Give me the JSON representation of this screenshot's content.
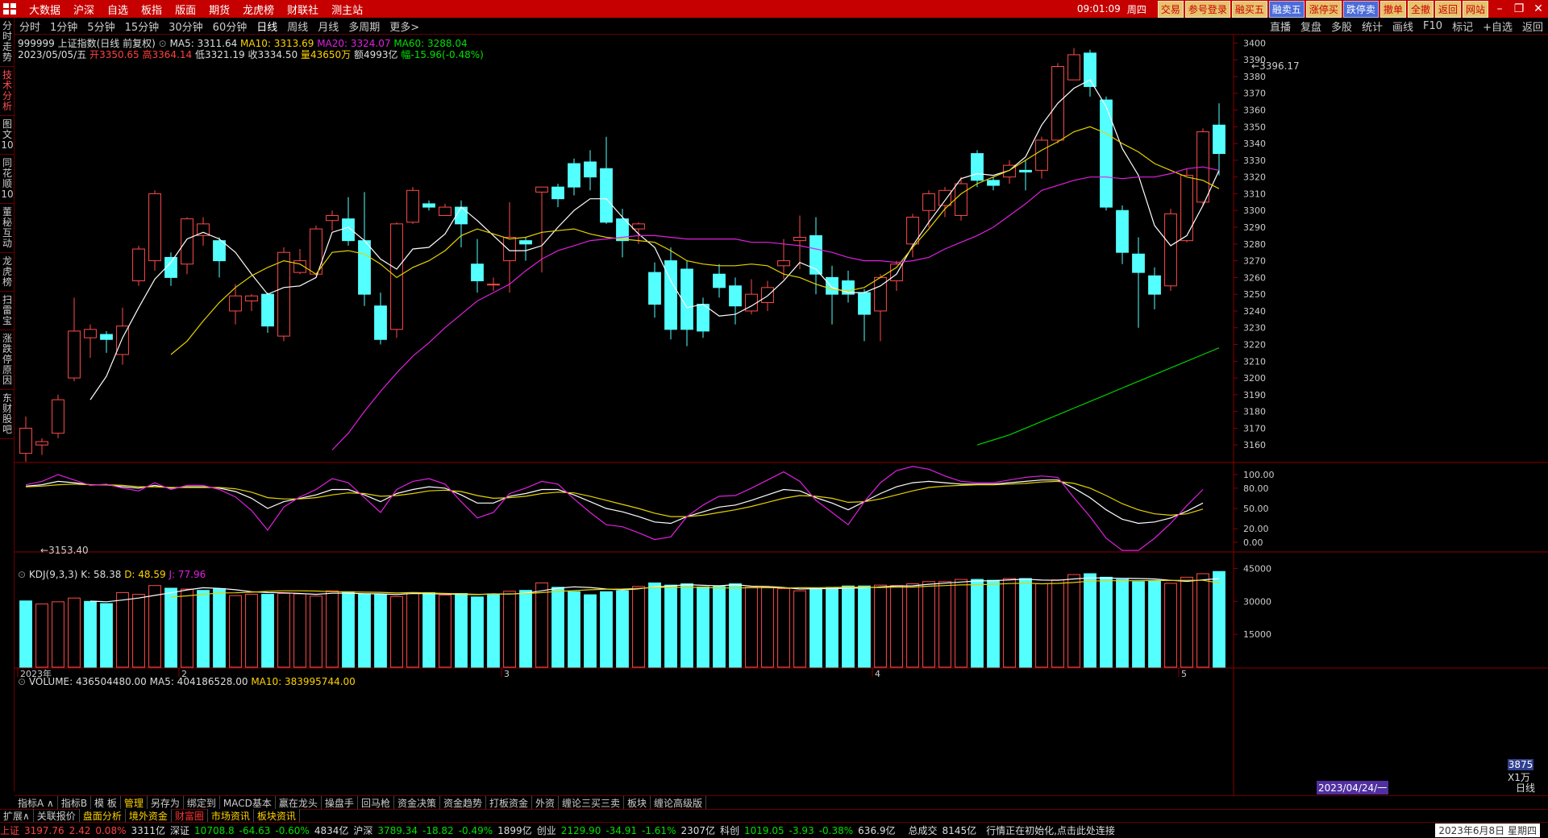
{
  "menu": {
    "items": [
      "大数据",
      "沪深",
      "自选",
      "板指",
      "版面",
      "期货",
      "龙虎榜",
      "财联社",
      "测主站"
    ],
    "time": "09:01:09",
    "weekday": "周四",
    "quick": [
      "交易",
      "参号登录",
      "融买五",
      "融卖五",
      "涨停买",
      "跌停卖",
      "撤单",
      "全撤",
      "返回",
      "网站"
    ]
  },
  "periods": [
    "分时",
    "1分钟",
    "5分钟",
    "15分钟",
    "30分钟",
    "60分钟",
    "日线",
    "周线",
    "月线",
    "多周期",
    "更多>"
  ],
  "toolbar_right": [
    "直播",
    "复盘",
    "多股",
    "统计",
    "画线",
    "F10",
    "标记",
    "+自选",
    "返回"
  ],
  "sidebar": [
    "分时走势",
    "技术分析",
    "图文10",
    "同花顺10",
    "董秘互动",
    "龙虎榜",
    "扫雷宝",
    "涨跌停原因",
    "东财股吧"
  ],
  "info": {
    "code_name": "999999 上证指数(日线 前复权)",
    "ma5_label": "MA5: 3311.64",
    "ma10_label": "MA10: 3313.69",
    "ma20_label": "MA20: 3324.07",
    "ma60_label": "MA60: 3288.04",
    "date": "2023/05/05/五",
    "open_l": "开",
    "open": "3350.65",
    "high_l": "高",
    "high": "3364.14",
    "low_l": "低",
    "low": "3321.19",
    "close_l": "收",
    "close": "3334.50",
    "vol_l": "量",
    "vol": "43650万",
    "amt_l": "额",
    "amt": "4993亿",
    "chg_l": "幅",
    "chg": "-15.96(-0.48%)",
    "hi_mark": "3396.17",
    "lo_mark": "3153.40"
  },
  "kdj": {
    "label": "KDJ(9,3,3)",
    "k": "K: 58.38",
    "d": "D: 48.59",
    "j": "J: 77.96"
  },
  "volume": {
    "label": "VOLUME: 436504480.00",
    "ma5": "MA5: 404186528.00",
    "ma10": "MA10: 383995744.00",
    "cur": "3875",
    "unit": "X1万"
  },
  "chart_data": {
    "type": "candlestick",
    "price_ticks": [
      3160,
      3170,
      3180,
      3190,
      3200,
      3210,
      3220,
      3230,
      3240,
      3250,
      3260,
      3270,
      3280,
      3290,
      3300,
      3310,
      3320,
      3330,
      3340,
      3350,
      3360,
      3370,
      3380,
      3390,
      3400
    ],
    "kdj_ticks": [
      "100.00",
      "80.00",
      "50.00",
      "20.00",
      "0.00"
    ],
    "vol_ticks": [
      "45000",
      "30000",
      "15000"
    ],
    "x_labels": [
      {
        "i": 0,
        "t": "2023年"
      },
      {
        "i": 10,
        "t": "2"
      },
      {
        "i": 30,
        "t": "3"
      },
      {
        "i": 53,
        "t": "4"
      },
      {
        "i": 72,
        "t": "5"
      }
    ],
    "highlight_date": "2023/04/24/一",
    "candles": [
      [
        3155,
        3170,
        3150,
        3177
      ],
      [
        3160,
        3162,
        3154,
        3164
      ],
      [
        3167,
        3187,
        3164,
        3190
      ],
      [
        3200,
        3228,
        3198,
        3248
      ],
      [
        3224,
        3229,
        3212,
        3232
      ],
      [
        3226,
        3223,
        3215,
        3228
      ],
      [
        3214,
        3231,
        3208,
        3242
      ],
      [
        3258,
        3277,
        3255,
        3279
      ],
      [
        3270,
        3310,
        3264,
        3312
      ],
      [
        3272,
        3260,
        3255,
        3275
      ],
      [
        3268,
        3295,
        3262,
        3296
      ],
      [
        3285,
        3292,
        3279,
        3296
      ],
      [
        3282,
        3270,
        3260,
        3284
      ],
      [
        3240,
        3249,
        3232,
        3256
      ],
      [
        3246,
        3249,
        3240,
        3250
      ],
      [
        3250,
        3231,
        3227,
        3251
      ],
      [
        3225,
        3275,
        3222,
        3278
      ],
      [
        3263,
        3270,
        3262,
        3277
      ],
      [
        3262,
        3289,
        3261,
        3291
      ],
      [
        3294,
        3297,
        3288,
        3300
      ],
      [
        3295,
        3282,
        3279,
        3308
      ],
      [
        3282,
        3250,
        3243,
        3311
      ],
      [
        3243,
        3223,
        3220,
        3251
      ],
      [
        3229,
        3292,
        3224,
        3293
      ],
      [
        3293,
        3312,
        3292,
        3314
      ],
      [
        3304,
        3302,
        3300,
        3306
      ],
      [
        3297,
        3302,
        3297,
        3304
      ],
      [
        3302,
        3292,
        3278,
        3306
      ],
      [
        3268,
        3258,
        3251,
        3283
      ],
      [
        3256,
        3256,
        3252,
        3260
      ],
      [
        3270,
        3284,
        3251,
        3305
      ],
      [
        3282,
        3280,
        3270,
        3284
      ],
      [
        3311,
        3314,
        3263,
        3314
      ],
      [
        3314,
        3307,
        3302,
        3316
      ],
      [
        3328,
        3314,
        3309,
        3331
      ],
      [
        3329,
        3320,
        3312,
        3336
      ],
      [
        3325,
        3293,
        3292,
        3344
      ],
      [
        3295,
        3282,
        3272,
        3301
      ],
      [
        3289,
        3292,
        3280,
        3293
      ],
      [
        3263,
        3244,
        3236,
        3269
      ],
      [
        3270,
        3229,
        3223,
        3278
      ],
      [
        3265,
        3229,
        3219,
        3270
      ],
      [
        3244,
        3228,
        3224,
        3248
      ],
      [
        3262,
        3254,
        3248,
        3268
      ],
      [
        3255,
        3243,
        3232,
        3260
      ],
      [
        3240,
        3250,
        3238,
        3259
      ],
      [
        3245,
        3254,
        3240,
        3258
      ],
      [
        3267,
        3270,
        3259,
        3283
      ],
      [
        3282,
        3284,
        3265,
        3297
      ],
      [
        3285,
        3262,
        3250,
        3296
      ],
      [
        3260,
        3250,
        3232,
        3267
      ],
      [
        3258,
        3250,
        3245,
        3264
      ],
      [
        3251,
        3238,
        3222,
        3253
      ],
      [
        3240,
        3260,
        3222,
        3262
      ],
      [
        3258,
        3268,
        3252,
        3270
      ],
      [
        3280,
        3296,
        3272,
        3298
      ],
      [
        3300,
        3310,
        3290,
        3312
      ],
      [
        3303,
        3312,
        3296,
        3314
      ],
      [
        3297,
        3316,
        3294,
        3320
      ],
      [
        3334,
        3318,
        3314,
        3336
      ],
      [
        3318,
        3315,
        3312,
        3320
      ],
      [
        3320,
        3327,
        3316,
        3330
      ],
      [
        3324,
        3323,
        3312,
        3330
      ],
      [
        3324,
        3342,
        3319,
        3344
      ],
      [
        3342,
        3386,
        3340,
        3388
      ],
      [
        3378,
        3393,
        3378,
        3397
      ],
      [
        3394,
        3374,
        3368,
        3396
      ],
      [
        3366,
        3302,
        3300,
        3368
      ],
      [
        3300,
        3275,
        3268,
        3303
      ],
      [
        3274,
        3263,
        3230,
        3284
      ],
      [
        3261,
        3250,
        3241,
        3266
      ],
      [
        3255,
        3298,
        3252,
        3301
      ],
      [
        3282,
        3321,
        3281,
        3325
      ],
      [
        3305,
        3347,
        3303,
        3349
      ],
      [
        3351,
        3334,
        3321,
        3364
      ]
    ],
    "ma5": [
      null,
      null,
      null,
      null,
      3187,
      3201,
      3224,
      3242,
      3259,
      3269,
      3283,
      3287,
      3283,
      3275,
      3262,
      3250,
      3254,
      3255,
      3260,
      3287,
      3290,
      3282,
      3271,
      3265,
      3277,
      3278,
      3286,
      3302,
      3294,
      3285,
      3276,
      3276,
      3279,
      3290,
      3300,
      3307,
      3307,
      3296,
      3286,
      3278,
      3258,
      3242,
      3244,
      3237,
      3238,
      3243,
      3249,
      3258,
      3269,
      3265,
      3254,
      3251,
      3251,
      3255,
      3262,
      3279,
      3293,
      3306,
      3319,
      3322,
      3321,
      3324,
      3332,
      3351,
      3364,
      3373,
      3378,
      3362,
      3337,
      3321,
      3291,
      3279,
      3285,
      3303,
      3324
    ],
    "ma10": [
      null,
      null,
      null,
      null,
      null,
      null,
      null,
      null,
      null,
      3214,
      3222,
      3234,
      3245,
      3254,
      3261,
      3266,
      3270,
      3268,
      3262,
      3275,
      3276,
      3274,
      3268,
      3260,
      3266,
      3270,
      3276,
      3285,
      3289,
      3286,
      3283,
      3284,
      3287,
      3288,
      3289,
      3286,
      3284,
      3283,
      3282,
      3281,
      3276,
      3270,
      3268,
      3267,
      3267,
      3268,
      3267,
      3262,
      3260,
      3256,
      3253,
      3252,
      3254,
      3260,
      3266,
      3278,
      3289,
      3301,
      3310,
      3316,
      3320,
      3324,
      3330,
      3336,
      3341,
      3347,
      3350,
      3346,
      3340,
      3335,
      3328,
      3324,
      3320,
      3318,
      3313
    ],
    "ma20": [
      null,
      null,
      null,
      null,
      null,
      null,
      null,
      null,
      null,
      null,
      null,
      null,
      null,
      null,
      null,
      null,
      null,
      null,
      null,
      3157,
      3167,
      3180,
      3192,
      3203,
      3213,
      3221,
      3230,
      3238,
      3246,
      3251,
      3256,
      3264,
      3271,
      3276,
      3279,
      3282,
      3283,
      3284,
      3285,
      3285,
      3284,
      3283,
      3283,
      3283,
      3283,
      3281,
      3281,
      3280,
      3279,
      3277,
      3275,
      3272,
      3270,
      3270,
      3269,
      3270,
      3272,
      3277,
      3281,
      3285,
      3290,
      3297,
      3304,
      3312,
      3315,
      3318,
      3320,
      3320,
      3319,
      3320,
      3320,
      3322,
      3325,
      3326,
      3324
    ],
    "ma60": [
      null,
      null,
      null,
      null,
      null,
      null,
      null,
      null,
      null,
      null,
      null,
      null,
      null,
      null,
      null,
      null,
      null,
      null,
      null,
      null,
      null,
      null,
      null,
      null,
      null,
      null,
      null,
      null,
      null,
      null,
      null,
      null,
      null,
      null,
      null,
      null,
      null,
      null,
      null,
      null,
      null,
      null,
      null,
      null,
      null,
      null,
      null,
      null,
      null,
      null,
      null,
      null,
      null,
      null,
      null,
      null,
      null,
      null,
      null,
      3160,
      3163,
      3166,
      3170,
      3174,
      3178,
      3182,
      3186,
      3190,
      3194,
      3198,
      3202,
      3206,
      3210,
      3214,
      3218
    ],
    "kdj_k": [
      83,
      85,
      90,
      88,
      85,
      85,
      82,
      80,
      84,
      80,
      82,
      82,
      80,
      75,
      65,
      50,
      60,
      65,
      70,
      78,
      78,
      70,
      60,
      72,
      78,
      82,
      80,
      70,
      58,
      58,
      68,
      72,
      78,
      78,
      70,
      60,
      50,
      45,
      38,
      30,
      28,
      38,
      45,
      52,
      55,
      62,
      70,
      78,
      76,
      66,
      58,
      48,
      60,
      72,
      82,
      88,
      90,
      88,
      86,
      86,
      86,
      88,
      90,
      92,
      92,
      80,
      66,
      48,
      34,
      28,
      30,
      36,
      46,
      58
    ],
    "kdj_d": [
      82,
      83,
      85,
      86,
      85,
      85,
      84,
      82,
      82,
      81,
      81,
      81,
      81,
      79,
      74,
      66,
      64,
      64,
      66,
      70,
      73,
      72,
      68,
      69,
      72,
      76,
      77,
      75,
      69,
      65,
      66,
      68,
      72,
      74,
      73,
      68,
      62,
      56,
      50,
      43,
      38,
      38,
      40,
      44,
      48,
      53,
      59,
      65,
      69,
      68,
      65,
      59,
      60,
      64,
      70,
      76,
      81,
      83,
      84,
      85,
      85,
      86,
      87,
      89,
      90,
      87,
      80,
      69,
      57,
      48,
      42,
      40,
      42,
      49
    ],
    "kdj_j": [
      85,
      90,
      100,
      92,
      84,
      86,
      80,
      76,
      88,
      78,
      84,
      84,
      78,
      67,
      47,
      18,
      52,
      67,
      78,
      94,
      88,
      66,
      44,
      78,
      90,
      94,
      86,
      60,
      36,
      44,
      72,
      80,
      90,
      86,
      64,
      44,
      26,
      23,
      14,
      4,
      8,
      38,
      55,
      68,
      69,
      80,
      92,
      104,
      90,
      62,
      44,
      26,
      60,
      88,
      106,
      112,
      108,
      98,
      90,
      88,
      88,
      92,
      96,
      98,
      96,
      66,
      38,
      6,
      -12,
      -12,
      6,
      28,
      54,
      78
    ],
    "vol": [
      302,
      288,
      298,
      315,
      300,
      290,
      340,
      332,
      372,
      360,
      356,
      350,
      358,
      326,
      332,
      332,
      336,
      334,
      324,
      348,
      344,
      334,
      332,
      322,
      340,
      340,
      328,
      336,
      320,
      334,
      346,
      350,
      384,
      364,
      344,
      330,
      344,
      348,
      368,
      384,
      374,
      380,
      366,
      368,
      380,
      364,
      366,
      358,
      348,
      356,
      364,
      370,
      370,
      374,
      372,
      380,
      390,
      390,
      400,
      400,
      396,
      404,
      404,
      380,
      398,
      422,
      426,
      410,
      400,
      390,
      394,
      382,
      410,
      426,
      436
    ],
    "vol_up": [
      false,
      true,
      true,
      true,
      false,
      false,
      true,
      true,
      true,
      false,
      true,
      false,
      false,
      true,
      true,
      false,
      true,
      true,
      true,
      true,
      false,
      false,
      false,
      true,
      true,
      false,
      true,
      false,
      false,
      false,
      true,
      false,
      true,
      false,
      false,
      false,
      false,
      false,
      true,
      false,
      false,
      false,
      false,
      false,
      false,
      true,
      true,
      true,
      true,
      false,
      false,
      false,
      false,
      true,
      true,
      true,
      true,
      true,
      true,
      false,
      false,
      true,
      false,
      true,
      true,
      true,
      false,
      false,
      false,
      false,
      false,
      true,
      true,
      true,
      false
    ],
    "vol_ma5": [
      null,
      null,
      null,
      null,
      301,
      298,
      306,
      315,
      327,
      339,
      352,
      362,
      359,
      353,
      344,
      340,
      339,
      336,
      332,
      337,
      337,
      335,
      334,
      331,
      336,
      335,
      333,
      332,
      331,
      334,
      333,
      337,
      348,
      360,
      366,
      363,
      356,
      352,
      357,
      366,
      370,
      376,
      373,
      371,
      376,
      369,
      368,
      363,
      356,
      358,
      358,
      360,
      361,
      366,
      370,
      371,
      378,
      383,
      388,
      393,
      394,
      398,
      401,
      397,
      396,
      402,
      407,
      406,
      405,
      404,
      402,
      396,
      391,
      398,
      404
    ],
    "vol_ma10": [
      null,
      null,
      null,
      null,
      null,
      null,
      null,
      null,
      null,
      320,
      325,
      332,
      338,
      339,
      342,
      346,
      348,
      348,
      347,
      344,
      343,
      342,
      341,
      338,
      340,
      338,
      336,
      334,
      332,
      333,
      334,
      335,
      340,
      345,
      349,
      353,
      355,
      356,
      359,
      363,
      364,
      364,
      363,
      361,
      361,
      362,
      362,
      361,
      362,
      362,
      363,
      365,
      364,
      363,
      365,
      365,
      369,
      372,
      375,
      376,
      378,
      381,
      383,
      380,
      382,
      386,
      392,
      394,
      394,
      394,
      395,
      395,
      396,
      396,
      384
    ]
  }
}
